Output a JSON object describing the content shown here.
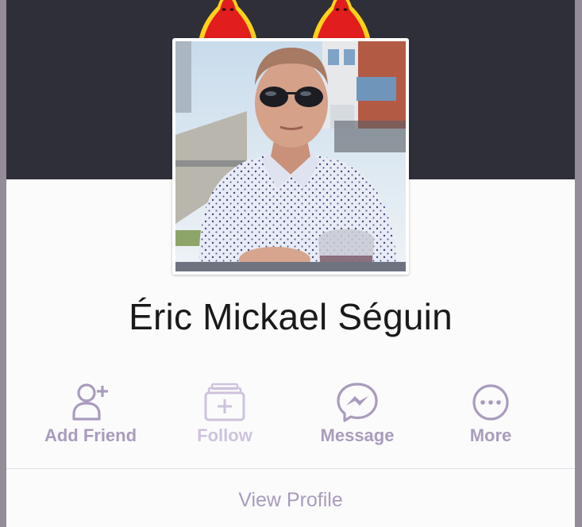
{
  "profile_card": {
    "name": "Éric Mickael Séguin",
    "cover_icon": "hooded-figure-illustration",
    "avatar_icon": "profile-photo"
  },
  "actions": [
    {
      "id": "add-friend",
      "label": "Add Friend",
      "icon": "add-friend-icon"
    },
    {
      "id": "follow",
      "label": "Follow",
      "icon": "follow-icon"
    },
    {
      "id": "message",
      "label": "Message",
      "icon": "messenger-icon"
    },
    {
      "id": "more",
      "label": "More",
      "icon": "more-icon"
    }
  ],
  "footer": {
    "view_profile_label": "View Profile"
  },
  "colors": {
    "accent": "#a99cbd",
    "accent_faded": "#cec3dc",
    "cover": "#2e2f39",
    "name_text": "#1a1a1a"
  }
}
